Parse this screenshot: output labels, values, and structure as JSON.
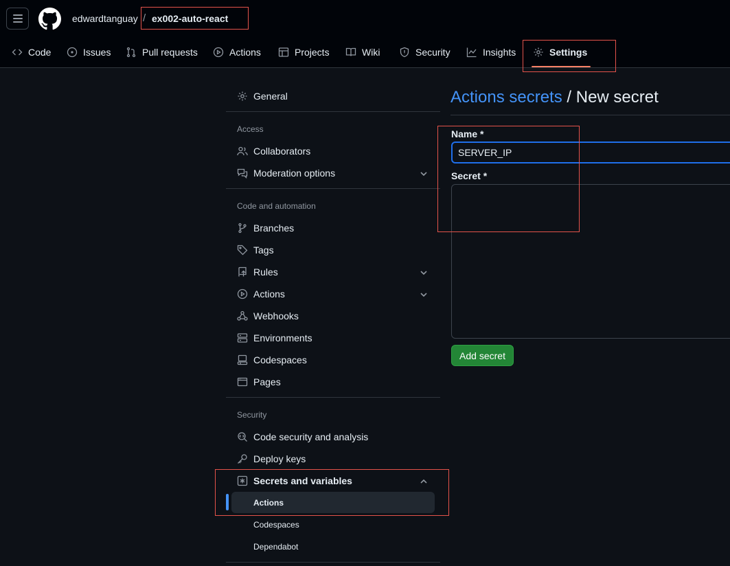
{
  "header": {
    "owner": "edwardtanguay",
    "separator": "/",
    "repo": "ex002-auto-react"
  },
  "tabs": [
    {
      "label": "Code",
      "icon": "code-icon"
    },
    {
      "label": "Issues",
      "icon": "issue-opened-icon"
    },
    {
      "label": "Pull requests",
      "icon": "git-pull-request-icon"
    },
    {
      "label": "Actions",
      "icon": "play-icon"
    },
    {
      "label": "Projects",
      "icon": "table-icon"
    },
    {
      "label": "Wiki",
      "icon": "book-icon"
    },
    {
      "label": "Security",
      "icon": "shield-icon"
    },
    {
      "label": "Insights",
      "icon": "graph-icon"
    },
    {
      "label": "Settings",
      "icon": "gear-icon",
      "active": true
    }
  ],
  "sidebar": {
    "general": "General",
    "access_heading": "Access",
    "access": [
      {
        "label": "Collaborators",
        "icon": "people-icon"
      },
      {
        "label": "Moderation options",
        "icon": "comment-discussion-icon"
      }
    ],
    "code_heading": "Code and automation",
    "code": [
      {
        "label": "Branches",
        "icon": "git-branch-icon"
      },
      {
        "label": "Tags",
        "icon": "tag-icon"
      },
      {
        "label": "Rules",
        "icon": "repo-push-icon"
      },
      {
        "label": "Actions",
        "icon": "play-icon"
      },
      {
        "label": "Webhooks",
        "icon": "webhook-icon"
      },
      {
        "label": "Environments",
        "icon": "server-icon"
      },
      {
        "label": "Codespaces",
        "icon": "codespaces-icon"
      },
      {
        "label": "Pages",
        "icon": "browser-icon"
      }
    ],
    "security_heading": "Security",
    "security": [
      {
        "label": "Code security and analysis",
        "icon": "codescan-icon"
      },
      {
        "label": "Deploy keys",
        "icon": "key-icon"
      },
      {
        "label": "Secrets and variables",
        "icon": "key-asterisk-icon"
      }
    ],
    "secrets_sub": [
      "Actions",
      "Codespaces",
      "Dependabot"
    ]
  },
  "main": {
    "breadcrumb_link": "Actions secrets",
    "breadcrumb_rest": " / New secret",
    "name_label": "Name *",
    "name_value": "SERVER_IP",
    "secret_label": "Secret *",
    "secret_value": "",
    "add_button": "Add secret"
  },
  "colors": {
    "accent_link": "#4493f8",
    "button_green": "#238636",
    "highlight_box": "#e5534b",
    "tab_underline": "#f78166"
  }
}
